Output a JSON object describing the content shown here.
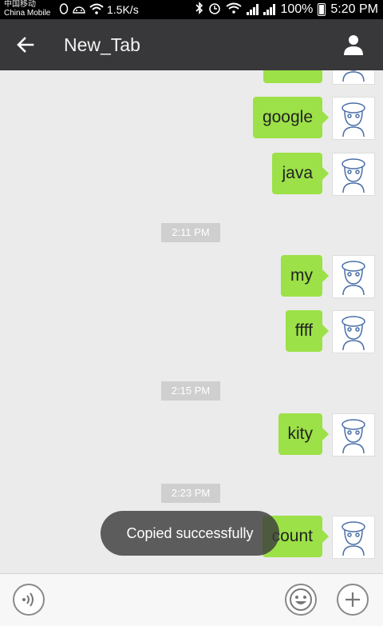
{
  "status_bar": {
    "carrier_line1": "中国移动",
    "carrier_line2": "China Mobile",
    "speed": "1.5K/s",
    "battery": "100%",
    "time": "5:20 PM"
  },
  "header": {
    "title": "New_Tab",
    "back_icon": "arrow-left-icon",
    "profile_icon": "person-icon"
  },
  "messages": [
    {
      "text": "",
      "partial": true
    },
    {
      "text": "google"
    },
    {
      "text": "java"
    },
    {
      "text": "my"
    },
    {
      "text": "ffff"
    },
    {
      "text": "kity"
    },
    {
      "text": "count"
    }
  ],
  "timestamps": [
    "2:11 PM",
    "2:15 PM",
    "2:23 PM"
  ],
  "toast": "Copied successfully",
  "input_bar": {
    "voice_icon": "voice-icon",
    "emoji_icon": "emoji-icon",
    "add_icon": "plus-icon"
  },
  "colors": {
    "header_bg": "#38383a",
    "bubble_green": "#9ce147",
    "chat_bg": "#ebebeb"
  }
}
